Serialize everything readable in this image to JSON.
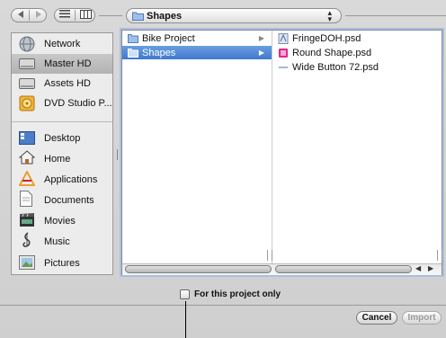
{
  "toolbar": {
    "back_icon": "back-arrow-icon",
    "forward_icon": "forward-arrow-icon",
    "list_view_icon": "list-view-icon",
    "column_view_icon": "column-view-icon",
    "location": "Shapes"
  },
  "sidebar": {
    "devices": [
      {
        "label": "Network",
        "icon": "network-globe-icon"
      },
      {
        "label": "Master HD",
        "icon": "hard-drive-icon",
        "selected": true
      },
      {
        "label": "Assets HD",
        "icon": "hard-drive-icon"
      },
      {
        "label": "DVD Studio P...",
        "icon": "dvd-icon"
      }
    ],
    "places": [
      {
        "label": "Desktop",
        "icon": "desktop-icon"
      },
      {
        "label": "Home",
        "icon": "home-icon"
      },
      {
        "label": "Applications",
        "icon": "applications-icon"
      },
      {
        "label": "Documents",
        "icon": "documents-icon"
      },
      {
        "label": "Movies",
        "icon": "movies-icon"
      },
      {
        "label": "Music",
        "icon": "music-icon"
      },
      {
        "label": "Pictures",
        "icon": "pictures-icon"
      }
    ]
  },
  "browser": {
    "column1": [
      {
        "label": "Bike Project",
        "icon": "folder-icon",
        "selected": false
      },
      {
        "label": "Shapes",
        "icon": "folder-icon",
        "selected": true
      }
    ],
    "column2": [
      {
        "label": "FringeDOH.psd",
        "icon": "psd-file-icon"
      },
      {
        "label": "Round Shape.psd",
        "icon": "psd-file-icon"
      },
      {
        "label": "Wide Button 72.psd",
        "icon": "psd-file-icon"
      }
    ]
  },
  "options": {
    "project_only_label": "For this project only",
    "project_only_checked": false
  },
  "buttons": {
    "cancel": "Cancel",
    "import": "Import"
  },
  "colors": {
    "selection": "#4a82d4",
    "accent_ring": "#a9bfe0"
  }
}
